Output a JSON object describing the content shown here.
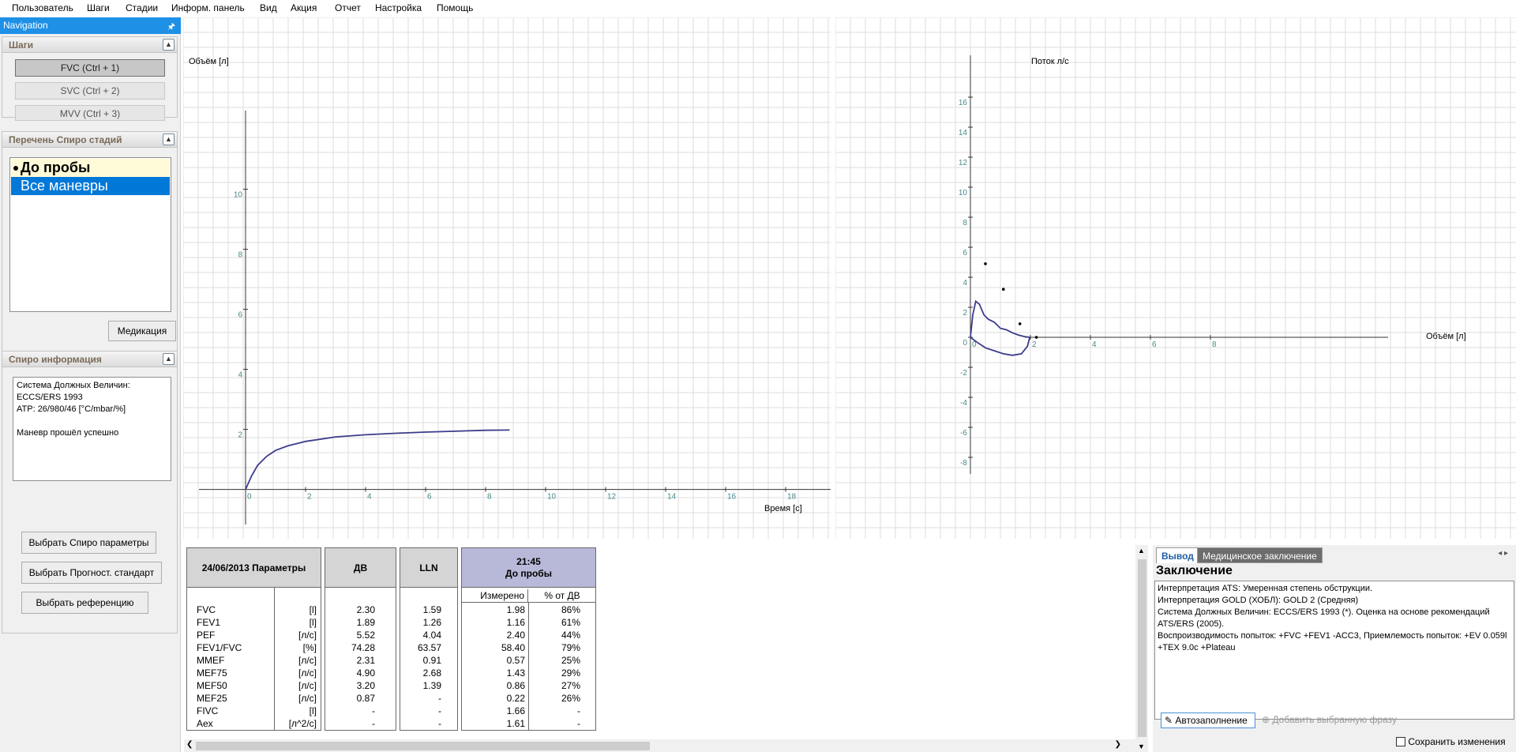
{
  "menu": [
    "Пользователь",
    "Шаги",
    "Стадии",
    "Информ. панель",
    "Вид",
    "Акция",
    "Отчет",
    "Настройка",
    "Помощь"
  ],
  "nav": {
    "title": "Navigation",
    "steps_header": "Шаги",
    "steps": [
      "FVC (Ctrl + 1)",
      "SVC (Ctrl + 2)",
      "MVV (Ctrl + 3)"
    ],
    "stages_header": "Перечень Спиро стадий",
    "stages": [
      "До пробы",
      "Все маневры"
    ],
    "medication_button": "Медикация",
    "info_header": "Спиро информация",
    "info_lines": [
      "Система Должных Величин:",
      "ECCS/ERS 1993",
      "ATP: 26/980/46 [°C/mbar/%]",
      "",
      "Маневр прошёл успешно"
    ],
    "buttons": [
      "Выбрать Спиро параметры",
      "Выбрать Прогност. стандарт",
      "Выбрать референцию"
    ]
  },
  "chart_data": [
    {
      "type": "line",
      "xlabel": "Время  [с]",
      "ylabel": "Объём  [л]",
      "xlim": [
        0,
        19
      ],
      "ylim": [
        -0.3,
        12
      ],
      "x_ticks": [
        0,
        2,
        4,
        6,
        8,
        10,
        12,
        14,
        16,
        18
      ],
      "y_ticks": [
        2,
        4,
        6,
        8,
        10
      ],
      "grid": true,
      "series": [
        {
          "x": [
            0,
            0.2,
            0.4,
            0.7,
            1.0,
            1.4,
            2.0,
            3.0,
            4.0,
            5.0,
            6.0,
            7.0,
            8.0,
            8.8
          ],
          "y": [
            0,
            0.45,
            0.8,
            1.1,
            1.3,
            1.45,
            1.6,
            1.75,
            1.82,
            1.87,
            1.91,
            1.94,
            1.97,
            1.98
          ]
        }
      ],
      "color": "#3c3c8c"
    },
    {
      "type": "line",
      "xlabel": "Объём  [л]",
      "ylabel": "Поток л/с",
      "xlim": [
        -2,
        10
      ],
      "ylim": [
        -10,
        18
      ],
      "x_ticks": [
        0,
        2,
        4,
        6,
        8
      ],
      "y_ticks": [
        -8,
        -6,
        -4,
        -2,
        0,
        2,
        4,
        6,
        8,
        10,
        12,
        14,
        16
      ],
      "grid": true,
      "series": [
        {
          "x": [
            0,
            0.08,
            0.18,
            0.3,
            0.45,
            0.6,
            0.8,
            1.0,
            1.2,
            1.4,
            1.6,
            1.8,
            1.98
          ],
          "y": [
            0,
            1.5,
            2.4,
            2.2,
            1.5,
            1.2,
            1.0,
            0.6,
            0.5,
            0.3,
            0.15,
            0.05,
            0
          ]
        },
        {
          "x": [
            0,
            0.2,
            0.5,
            0.8,
            1.1,
            1.4,
            1.7,
            1.9,
            1.98
          ],
          "y": [
            0,
            -0.3,
            -0.7,
            -0.9,
            -1.1,
            -1.2,
            -1.1,
            -0.6,
            0
          ]
        }
      ],
      "points": [
        {
          "x": 0.5,
          "y": 4.9
        },
        {
          "x": 1.1,
          "y": 3.2
        },
        {
          "x": 1.65,
          "y": 0.9
        },
        {
          "x": 2.2,
          "y": 0
        }
      ],
      "color": "#3c3c8c"
    }
  ],
  "table": {
    "head_params": "24/06/2013 Параметры",
    "head_pred": "ДВ",
    "head_lln": "LLN",
    "head_meas_time": "21:45",
    "head_meas_stage": "До пробы",
    "sub_measured": "Измерено",
    "sub_percent": "% от ДВ",
    "rows": [
      {
        "param": "FVC",
        "unit": "[l]",
        "pred": "2.30",
        "lln": "1.59",
        "meas": "1.98",
        "pct": "86%"
      },
      {
        "param": "FEV1",
        "unit": "[l]",
        "pred": "1.89",
        "lln": "1.26",
        "meas": "1.16",
        "pct": "61%"
      },
      {
        "param": "PEF",
        "unit": "[л/с]",
        "pred": "5.52",
        "lln": "4.04",
        "meas": "2.40",
        "pct": "44%"
      },
      {
        "param": "FEV1/FVC",
        "unit": "[%]",
        "pred": "74.28",
        "lln": "63.57",
        "meas": "58.40",
        "pct": "79%"
      },
      {
        "param": "MMEF",
        "unit": "[л/с]",
        "pred": "2.31",
        "lln": "0.91",
        "meas": "0.57",
        "pct": "25%"
      },
      {
        "param": "MEF75",
        "unit": "[л/с]",
        "pred": "4.90",
        "lln": "2.68",
        "meas": "1.43",
        "pct": "29%"
      },
      {
        "param": "MEF50",
        "unit": "[л/с]",
        "pred": "3.20",
        "lln": "1.39",
        "meas": "0.86",
        "pct": "27%"
      },
      {
        "param": "MEF25",
        "unit": "[л/с]",
        "pred": "0.87",
        "lln": "-",
        "meas": "0.22",
        "pct": "26%"
      },
      {
        "param": "FIVC",
        "unit": "[l]",
        "pred": "-",
        "lln": "-",
        "meas": "1.66",
        "pct": "-"
      },
      {
        "param": "Aex",
        "unit": "[л^2/с]",
        "pred": "-",
        "lln": "-",
        "meas": "1.61",
        "pct": "-"
      }
    ]
  },
  "right": {
    "tab_output": "Вывод",
    "tab_medical": "Медицинское заключение",
    "title": "Заключение",
    "lines": [
      "Интерпретация ATS: Умеренная степень обструкции.",
      "Интерпретация GOLD (ХОБЛ): GOLD 2 (Средняя)",
      "Система Должных Величин: ECCS/ERS 1993 (*). Оценка на основе рекомендаций ATS/ERS (2005).",
      "Воспроизводимость  попыток: +FVC +FEV1 -ACC3, Приемлемость  попыток: +EV 0.059l +TEX 9.0c +Plateau"
    ],
    "autofill": "Автозаполнение",
    "add_phrase": "Добавить выбранную фразу",
    "save_changes": "Сохранить изменения"
  }
}
